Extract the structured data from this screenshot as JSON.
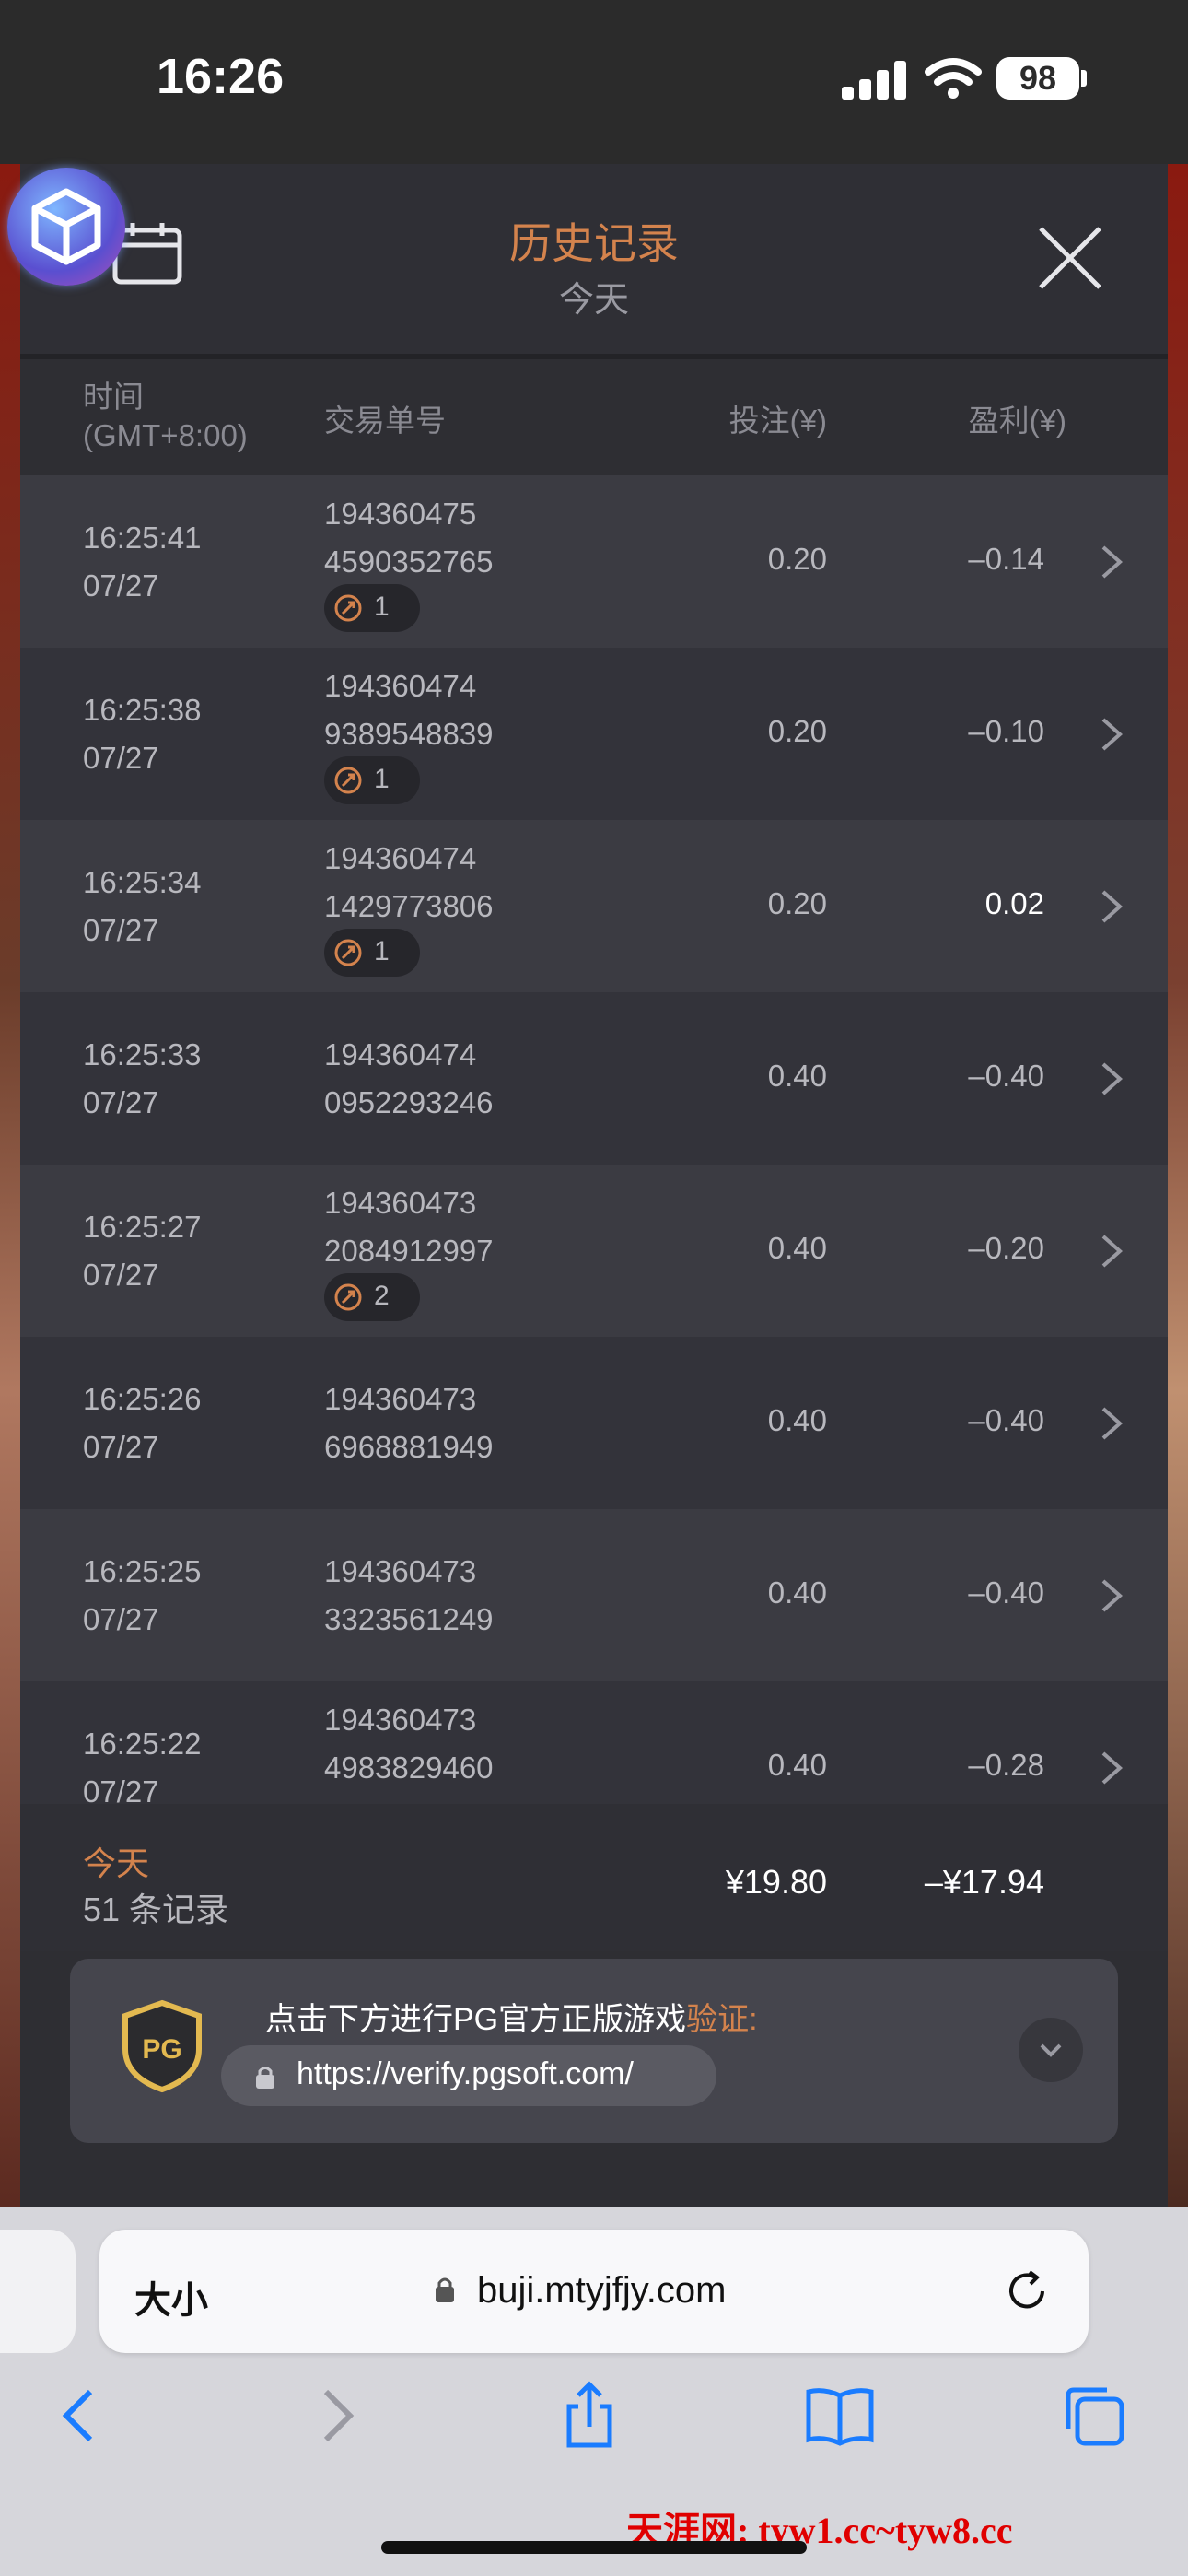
{
  "status_bar": {
    "time": "16:26",
    "battery": "98"
  },
  "header": {
    "title": "历史记录",
    "subtitle": "今天"
  },
  "columns": {
    "time": "时间",
    "timezone": "(GMT+8:00)",
    "tx_id": "交易单号",
    "bet": "投注(¥)",
    "profit": "盈利(¥)"
  },
  "rows": [
    {
      "time": "16:25:41",
      "date": "07/27",
      "id1": "194360475",
      "id2": "4590352765",
      "badge": "1",
      "bet": "0.20",
      "profit": "–0.14"
    },
    {
      "time": "16:25:38",
      "date": "07/27",
      "id1": "194360474",
      "id2": "9389548839",
      "badge": "1",
      "bet": "0.20",
      "profit": "–0.10"
    },
    {
      "time": "16:25:34",
      "date": "07/27",
      "id1": "194360474",
      "id2": "1429773806",
      "badge": "1",
      "bet": "0.20",
      "profit": "0.02"
    },
    {
      "time": "16:25:33",
      "date": "07/27",
      "id1": "194360474",
      "id2": "0952293246",
      "badge": null,
      "bet": "0.40",
      "profit": "–0.40"
    },
    {
      "time": "16:25:27",
      "date": "07/27",
      "id1": "194360473",
      "id2": "2084912997",
      "badge": "2",
      "bet": "0.40",
      "profit": "–0.20"
    },
    {
      "time": "16:25:26",
      "date": "07/27",
      "id1": "194360473",
      "id2": "6968881949",
      "badge": null,
      "bet": "0.40",
      "profit": "–0.40"
    },
    {
      "time": "16:25:25",
      "date": "07/27",
      "id1": "194360473",
      "id2": "3323561249",
      "badge": null,
      "bet": "0.40",
      "profit": "–0.40"
    },
    {
      "time": "16:25:22",
      "date": "07/27",
      "id1": "194360473",
      "id2": "4983829460",
      "badge": null,
      "bet": "0.40",
      "profit": "–0.28"
    }
  ],
  "summary": {
    "label": "今天",
    "count": "51 条记录",
    "total_bet": "¥19.80",
    "total_profit": "–¥17.94"
  },
  "verify": {
    "text": "点击下方进行PG官方正版游戏",
    "accent": "验证:",
    "logo_text": "PG",
    "url": "https://verify.pgsoft.com/"
  },
  "browser": {
    "text_size": "大小",
    "address": "buji.mtyjfjy.com"
  },
  "watermark": "天涯网:  tyw1.cc~tyw8.cc",
  "colors": {
    "accent": "#d4834d",
    "panel": "#2e2e33"
  }
}
